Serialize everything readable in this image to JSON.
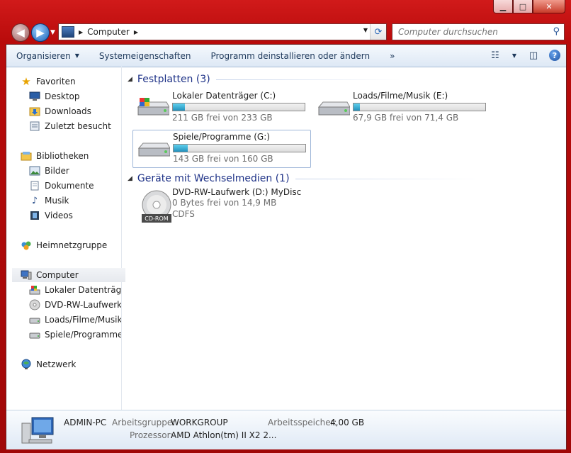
{
  "window": {
    "minimize_label": "▁",
    "maximize_label": "□",
    "close_label": "✕"
  },
  "address_bar": {
    "path": [
      "Computer"
    ],
    "search_placeholder": "Computer durchsuchen"
  },
  "toolbar": {
    "organize": "Organisieren",
    "system_properties": "Systemeigenschaften",
    "uninstall": "Programm deinstallieren oder ändern",
    "more": "»"
  },
  "nav": {
    "favorites": "Favoriten",
    "desktop": "Desktop",
    "downloads": "Downloads",
    "recent": "Zuletzt besucht",
    "libraries": "Bibliotheken",
    "pictures": "Bilder",
    "documents": "Dokumente",
    "music": "Musik",
    "videos": "Videos",
    "homegroup": "Heimnetzgruppe",
    "computer": "Computer",
    "drive_c": "Lokaler Datenträger",
    "drive_d": "DVD-RW-Laufwerk (",
    "drive_e": "Loads/Filme/Musik",
    "drive_g": "Spiele/Programme (",
    "network": "Netzwerk"
  },
  "groups": {
    "hdd_header": "Festplatten (3)",
    "removable_header": "Geräte mit Wechselmedien (1)"
  },
  "drives": {
    "c": {
      "name": "Lokaler Datenträger (C:)",
      "free": "211 GB frei von 233 GB",
      "used_fraction": 0.094
    },
    "e": {
      "name": "Loads/Filme/Musik (E:)",
      "free": "67,9 GB frei von 71,4 GB",
      "used_fraction": 0.049
    },
    "g": {
      "name": "Spiele/Programme (G:)",
      "free": "143 GB frei von 160 GB",
      "used_fraction": 0.106
    },
    "d": {
      "name": "DVD-RW-Laufwerk (D:) MyDisc",
      "free": "0 Bytes frei von 14,9 MB",
      "fs": "CDFS",
      "badge": "CD-ROM"
    }
  },
  "details": {
    "computer_name": "ADMIN-PC",
    "workgroup_label": "Arbeitsgruppe:",
    "workgroup_value": "WORKGROUP",
    "memory_label": "Arbeitsspeicher:",
    "memory_value": "4,00 GB",
    "cpu_label": "Prozessor:",
    "cpu_value": "AMD Athlon(tm) II X2 2..."
  },
  "colors": {
    "frame": "#b80b0b",
    "accent": "#1e3287",
    "bar_fill": "#2391bd"
  }
}
